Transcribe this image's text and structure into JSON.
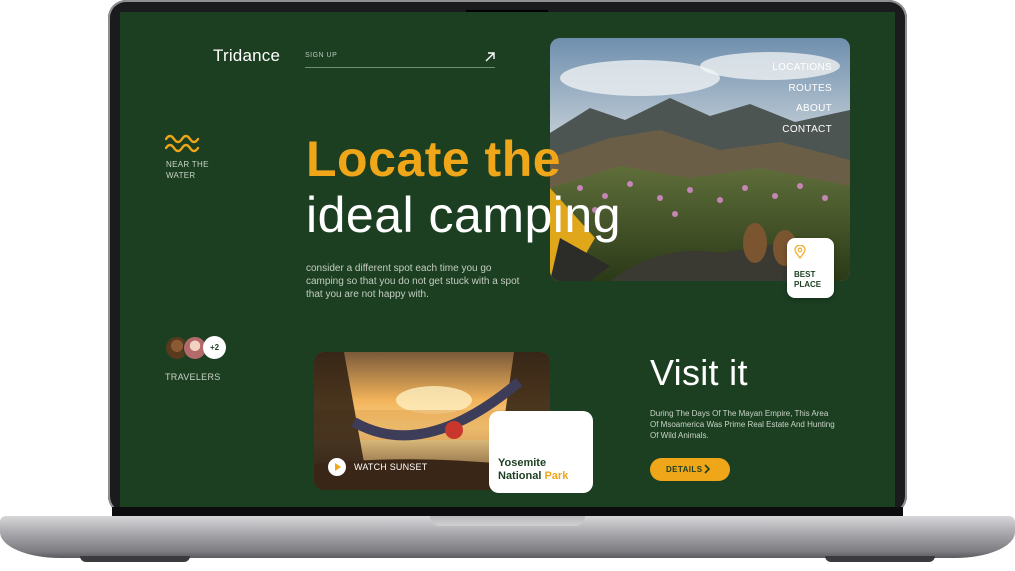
{
  "brand": "Tridance",
  "header": {
    "signup_label": "SIGN UP"
  },
  "nav": {
    "items": [
      {
        "label": "LOCATIONS"
      },
      {
        "label": "ROUTES"
      },
      {
        "label": "ABOUT"
      },
      {
        "label": "CONTACT"
      }
    ]
  },
  "feature": {
    "label": "NEAR THE WATER",
    "icon": "waves-icon"
  },
  "hero": {
    "headline_line1": "Locate the",
    "headline_line2": "ideal camping",
    "description": "consider a different spot each time you go camping so that you do not get stuck with a spot that you are not happy with.",
    "image": "mountain-camping-photo"
  },
  "best_place": {
    "label": "BEST PLACE",
    "icon": "location-pin-icon"
  },
  "travelers": {
    "more_count": "+2",
    "label": "TRAVELERS"
  },
  "video": {
    "label": "WATCH SUNSET",
    "image": "sunset-hammock-photo"
  },
  "location_card": {
    "line1": "Yosemite",
    "line2_a": "National ",
    "line2_b": "Park"
  },
  "visit": {
    "title": "Visit it",
    "description": "During The Days Of The Mayan Empire, This Area Of Msoamerica Was Prime Real Estate And Hunting Of Wild Animals.",
    "button_label": "DETAILS"
  },
  "colors": {
    "background": "#1c3f22",
    "accent": "#f0a619",
    "text": "#ffffff"
  }
}
